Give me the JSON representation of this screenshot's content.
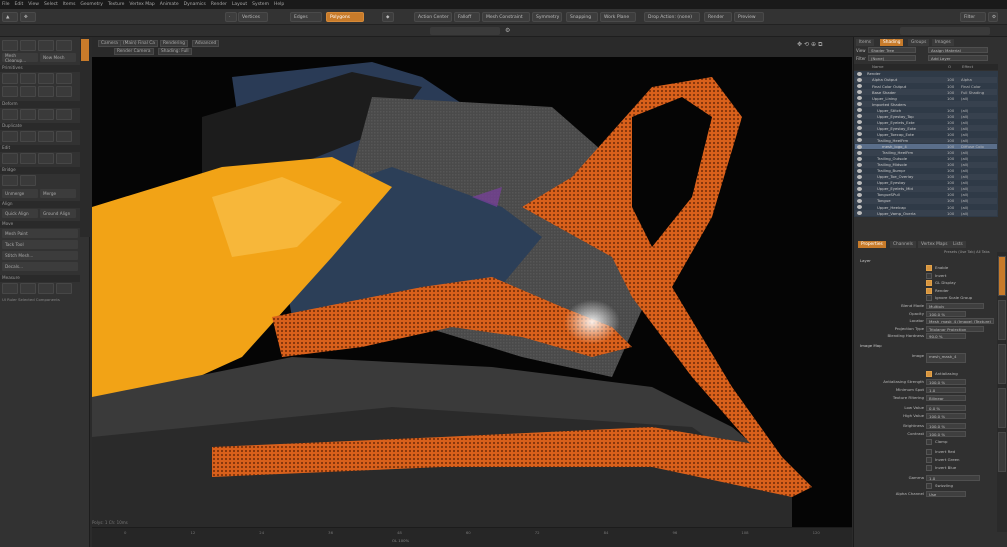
{
  "menu": [
    "File",
    "Edit",
    "View",
    "Select",
    "Items",
    "Geometry",
    "Texture",
    "Vertex Map",
    "Animate",
    "Dynamics",
    "Render",
    "Layout",
    "System",
    "Help"
  ],
  "toolbar": {
    "vertices": "Vertices",
    "edges": "Edges",
    "polygons": "Polygons",
    "action_center": "Action Center",
    "falloff": "Falloff",
    "mesh_constraint": "Mesh Constraint",
    "symmetry": "Symmetry",
    "snapping": "Snapping",
    "work_plane": "Work Plane",
    "drop_action": "Drop Action: (none)",
    "render": "Render",
    "preview": "Preview",
    "search_placeholder": "Filter"
  },
  "left_panel": {
    "top_buttons": [
      "Mesh Cleanup...",
      "New Mesh"
    ],
    "sections": [
      "Primitives",
      "Deform",
      "Duplicate",
      "Edit",
      "Bridge",
      "Align",
      "Move",
      "Measure"
    ],
    "edit_rows": [
      "Unmerge",
      "Merge"
    ],
    "align_rows": [
      "Quick Align",
      "Ground Align"
    ],
    "move_rows": [
      "Mesh Paint",
      "Tack Tool",
      "Stitch Mesh...",
      "Decals..."
    ],
    "footer": "UI Ruler  Selected Components"
  },
  "viewport": {
    "tabs": [
      "Camera",
      "(Main) Final Ca",
      "Rendering",
      "Advanced",
      "Render Camera",
      "Shading: Full"
    ],
    "status": "Polys: 1   Ch: 10ms",
    "zoom_label": "OL 100%"
  },
  "timeline": {
    "frames": [
      "0",
      "12",
      "24",
      "36",
      "48",
      "60",
      "72",
      "84",
      "96",
      "108",
      "120"
    ]
  },
  "right_panel": {
    "top_tabs": [
      "Items",
      "Shading",
      "Groups",
      "Images"
    ],
    "selected_tab": "Shading",
    "view_label": "View",
    "view_value": "Shader Tree",
    "assign_button": "Assign Material",
    "filter_label": "Filter",
    "filter_value": "(None)",
    "add_layer": "Add Layer",
    "columns": [
      "Name",
      "O",
      "Effect"
    ],
    "rows": [
      {
        "indent": 0,
        "name": "Render",
        "pct": "",
        "effect": ""
      },
      {
        "indent": 1,
        "name": "Alpha Output",
        "pct": "100",
        "effect": "Alpha"
      },
      {
        "indent": 1,
        "name": "Final Color Output",
        "pct": "100",
        "effect": "Final Color"
      },
      {
        "indent": 1,
        "name": "Base Shader",
        "pct": "100",
        "effect": "Full Shading"
      },
      {
        "indent": 1,
        "name": "Upper_Lining",
        "pct": "100",
        "effect": "(all)"
      },
      {
        "indent": 1,
        "name": "Imported Shaders",
        "pct": "",
        "effect": ""
      },
      {
        "indent": 2,
        "name": "Upper_Stitch",
        "pct": "100",
        "effect": "(all)"
      },
      {
        "indent": 2,
        "name": "Upper_Eyestay_Top",
        "pct": "100",
        "effect": "(all)"
      },
      {
        "indent": 2,
        "name": "Upper_Eyelets_Exte",
        "pct": "100",
        "effect": "(all)"
      },
      {
        "indent": 2,
        "name": "Upper_Eyestay_Exte",
        "pct": "100",
        "effect": "(all)"
      },
      {
        "indent": 2,
        "name": "Upper_Toecap_Exte",
        "pct": "100",
        "effect": "(all)"
      },
      {
        "indent": 2,
        "name": "Trailing_HeelFrm",
        "pct": "100",
        "effect": "(all)"
      },
      {
        "indent": 3,
        "name": "mesh_logo_4",
        "pct": "100",
        "effect": "Diffuse Colo"
      },
      {
        "indent": 3,
        "name": "Trailing_HeelFrm",
        "pct": "100",
        "effect": "(all)"
      },
      {
        "indent": 2,
        "name": "Trailing_Outsole",
        "pct": "100",
        "effect": "(all)"
      },
      {
        "indent": 2,
        "name": "Trailing_Midsole",
        "pct": "100",
        "effect": "(all)"
      },
      {
        "indent": 2,
        "name": "Trailing_Bumpr",
        "pct": "100",
        "effect": "(all)"
      },
      {
        "indent": 2,
        "name": "Upper_Toe_Overlay",
        "pct": "100",
        "effect": "(all)"
      },
      {
        "indent": 2,
        "name": "Upper_Eyestay",
        "pct": "100",
        "effect": "(all)"
      },
      {
        "indent": 2,
        "name": "Upper_Eyelets_Mid",
        "pct": "100",
        "effect": "(all)"
      },
      {
        "indent": 2,
        "name": "TongueSPull",
        "pct": "100",
        "effect": "(all)"
      },
      {
        "indent": 2,
        "name": "Tongue",
        "pct": "100",
        "effect": "(all)"
      },
      {
        "indent": 2,
        "name": "Upper_Heelcap",
        "pct": "100",
        "effect": "(all)"
      },
      {
        "indent": 2,
        "name": "Upper_Vamp_Overla",
        "pct": "100",
        "effect": "(all)"
      }
    ],
    "selected_row": 12,
    "prop_tabs": [
      "Properties",
      "Channels",
      "Vertex Maps",
      "Lists"
    ],
    "presets": "Presets  (Use Tab)  All Tabs",
    "section_layer": "Layer",
    "enable": "Enable",
    "invert": "Invert",
    "gl_display": "GL Display",
    "render": "Render",
    "ignore_scale": "Ignore Scale Group",
    "blend_mode_label": "Blend Mode",
    "blend_mode": "Multiply",
    "opacity_label": "Opacity",
    "opacity": "100.0 %",
    "locator_label": "Locator",
    "locator": "Mesh_mask_4 (Image) (Texture)",
    "projection_label": "Projection Type",
    "projection": "Triplanar Projection",
    "blending_label": "Blending Hardness",
    "blending": "90.0 %",
    "section_image": "Image Map",
    "image_label": "Image",
    "image_value": "mesh_mask_4",
    "antialiasing": "Antialiasing",
    "aa_strength_label": "Antialiasing Strength",
    "aa_strength": "100.0 %",
    "min_spot_label": "Minimum Spot",
    "min_spot": "1.0",
    "texture_filter_label": "Texture Filtering",
    "texture_filter": "Bilinear",
    "low_value_label": "Low Value",
    "low_value": "0.0 %",
    "high_value_label": "High Value",
    "high_value": "100.0 %",
    "brightness_label": "Brightness",
    "brightness": "100.0 %",
    "contrast_label": "Contrast",
    "contrast": "100.0 %",
    "clamp": "Clamp",
    "invert_red": "Invert Red",
    "invert_green": "Invert Green",
    "invert_blue": "Invert Blue",
    "gamma_label": "Gamma",
    "gamma": "1.0",
    "swizzling": "Swizzling",
    "alpha_channel_label": "Alpha Channel",
    "alpha_channel": "Use"
  },
  "colors": {
    "accent": "#c87b2a",
    "selection": "#5a6e8a",
    "mesh_orange": "#d8601b",
    "upper_yellow": "#f2a316",
    "upper_navy": "#2c3f58"
  }
}
